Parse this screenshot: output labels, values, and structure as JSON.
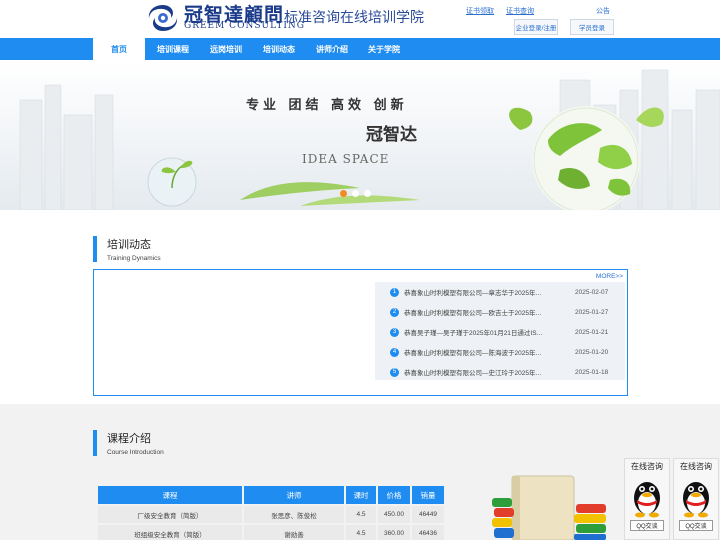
{
  "header": {
    "logo_cn": "冠智達顧問",
    "logo_en": "GREEM CONSULTING",
    "tagline": "标准咨询在线培训学院",
    "links": {
      "cert_receive": "证书领取",
      "cert_query": "证书查询",
      "notice": "公告"
    },
    "buttons": {
      "enterprise_login": "企业登录/注册",
      "student_login": "学员登录"
    }
  },
  "nav": {
    "items": [
      {
        "label": "首页",
        "active": true
      },
      {
        "label": "培训课程"
      },
      {
        "label": "远岗培训"
      },
      {
        "label": "培训动态"
      },
      {
        "label": "讲师介绍"
      },
      {
        "label": "关于学院"
      }
    ]
  },
  "banner": {
    "slogan": "专业 团结 高效 创新",
    "brand": "冠智达",
    "idea": "IDEA SPACE",
    "slides": 3,
    "active_slide": 1
  },
  "training_news": {
    "title": "培训动态",
    "subtitle": "Training Dynamics",
    "more": "MORE>>",
    "items": [
      {
        "num": "1",
        "text": "恭喜象山时利模塑有限公司—章志华于2025年…",
        "date": "2025-02-07"
      },
      {
        "num": "2",
        "text": "恭喜象山时利模塑有限公司—欧吉士于2025年…",
        "date": "2025-01-27"
      },
      {
        "num": "3",
        "text": "恭喜吴子瑾—吴子瑾于2025年01月21日通过IS…",
        "date": "2025-01-21"
      },
      {
        "num": "4",
        "text": "恭喜象山时利模塑有限公司—陈海波于2025年…",
        "date": "2025-01-20"
      },
      {
        "num": "5",
        "text": "恭喜象山时利模塑有限公司—史江玲于2025年…",
        "date": "2025-01-18"
      }
    ]
  },
  "courses": {
    "title": "课程介绍",
    "subtitle": "Course Introduction",
    "headers": [
      "课程",
      "讲师",
      "课时",
      "价格",
      "销量"
    ],
    "rows": [
      [
        "厂级安全教育（简版）",
        "张思彦、陈俊松",
        "4.5",
        "450.00",
        "46449"
      ],
      [
        "班组级安全教育（简版）",
        "谢勋善",
        "4.5",
        "360.00",
        "46436"
      ]
    ]
  },
  "qq_widgets": [
    {
      "title": "在线咨询",
      "button": "QQ交谈"
    },
    {
      "title": "在线咨询",
      "button": "QQ交谈"
    }
  ],
  "colors": {
    "primary": "#1e8cf0",
    "accent": "#f08a22",
    "logo": "#1a3a8a"
  }
}
